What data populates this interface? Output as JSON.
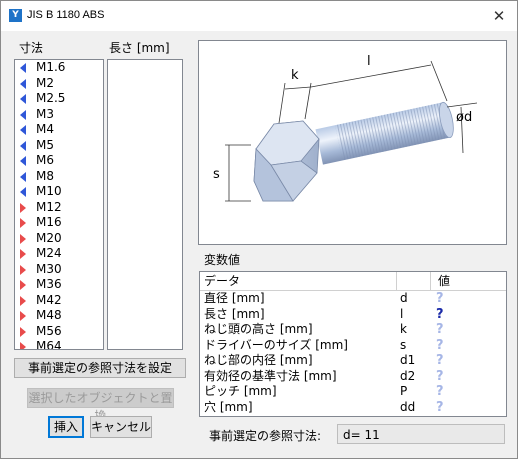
{
  "window": {
    "title": "JIS B 1180 ABS",
    "app_icon": "Y",
    "close_glyph": "✕"
  },
  "sizes": {
    "label": "寸法",
    "items": [
      {
        "label": "M1.6",
        "marker": "blue-left"
      },
      {
        "label": "M2",
        "marker": "blue-left"
      },
      {
        "label": "M2.5",
        "marker": "blue-left"
      },
      {
        "label": "M3",
        "marker": "blue-left"
      },
      {
        "label": "M4",
        "marker": "blue-left"
      },
      {
        "label": "M5",
        "marker": "blue-left"
      },
      {
        "label": "M6",
        "marker": "blue-left"
      },
      {
        "label": "M8",
        "marker": "blue-left"
      },
      {
        "label": "M10",
        "marker": "blue-left"
      },
      {
        "label": "M12",
        "marker": "red-right"
      },
      {
        "label": "M16",
        "marker": "red-right"
      },
      {
        "label": "M20",
        "marker": "red-right"
      },
      {
        "label": "M24",
        "marker": "red-right"
      },
      {
        "label": "M30",
        "marker": "red-right"
      },
      {
        "label": "M36",
        "marker": "red-right"
      },
      {
        "label": "M42",
        "marker": "red-right"
      },
      {
        "label": "M48",
        "marker": "red-right"
      },
      {
        "label": "M56",
        "marker": "red-right"
      },
      {
        "label": "M64",
        "marker": "red-right"
      }
    ]
  },
  "lengths": {
    "label": "長さ [mm]"
  },
  "diagram": {
    "k": "k",
    "l": "l",
    "s": "s",
    "d": "ød"
  },
  "variables": {
    "label": "変数値",
    "columns": {
      "data": "データ",
      "value": "値"
    },
    "rows": [
      {
        "name": "直径 [mm]",
        "symbol": "d",
        "status": "light"
      },
      {
        "name": "長さ [mm]",
        "symbol": "l",
        "status": "dark"
      },
      {
        "name": "ねじ頭の高さ [mm]",
        "symbol": "k",
        "status": "light"
      },
      {
        "name": "ドライバーのサイズ [mm]",
        "symbol": "s",
        "status": "light"
      },
      {
        "name": "ねじ部の内径 [mm]",
        "symbol": "d1",
        "status": "light"
      },
      {
        "name": "有効径の基準寸法 [mm]",
        "symbol": "d2",
        "status": "light"
      },
      {
        "name": "ピッチ [mm]",
        "symbol": "P",
        "status": "light"
      },
      {
        "name": "穴 [mm]",
        "symbol": "dd",
        "status": "light"
      }
    ],
    "placeholder": "?"
  },
  "buttons": {
    "set_reference": "事前選定の参照寸法を設定",
    "replace": "選択したオブジェクトと置換",
    "insert": "挿入",
    "cancel": "キャンセル"
  },
  "reference": {
    "label": "事前選定の参照寸法:",
    "value": "d= 11"
  },
  "colors": {
    "marker_blue": "#2f57d8",
    "marker_red": "#e84b4b",
    "q_light": "#a6b6e6",
    "q_dark": "#1a2aa8"
  }
}
